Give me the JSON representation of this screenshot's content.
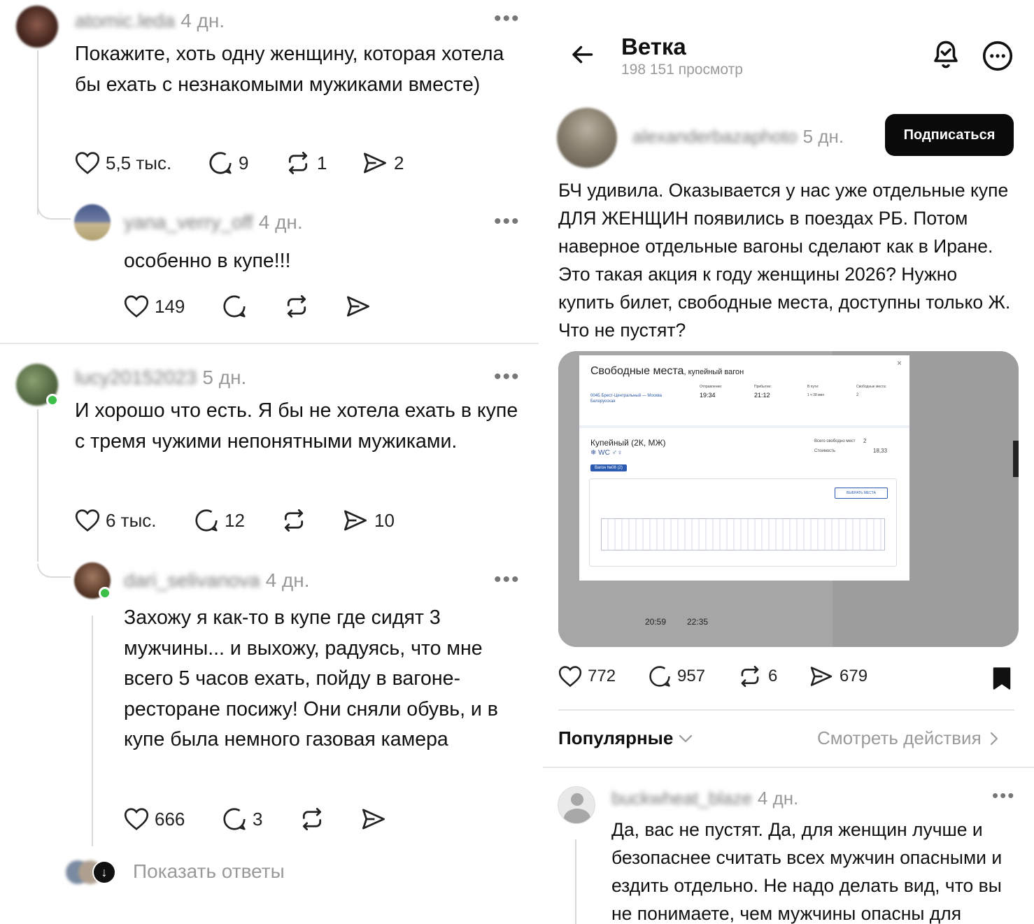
{
  "left": {
    "comments": [
      {
        "username": "atomic.leda",
        "time": "4 дн.",
        "text": "Покажите, хоть одну женщину, которая хотела бы ехать с незнакомыми мужиками вместе)",
        "likes": "5,5 тыс.",
        "replies": "9",
        "reposts": "1",
        "shares": "2"
      },
      {
        "username": "yana_verry_off",
        "time": "4 дн.",
        "text": "особенно в купе!!!",
        "likes": "149",
        "replies": "",
        "reposts": "",
        "shares": ""
      },
      {
        "username": "lucy20152023",
        "time": "5 дн.",
        "text": "И хорошо что есть. Я бы не хотела ехать в купе с тремя чужими непонятными мужиками.",
        "likes": "6 тыс.",
        "replies": "12",
        "reposts": "",
        "shares": "10"
      },
      {
        "username": "dari_selivanova",
        "time": "4 дн.",
        "text": "Захожу я как-то в купе где сидят 3 мужчины... и выхожу, радуясь, что мне всего 5 часов ехать, пойду в вагоне-ресторане посижу! Они сняли обувь, и в купе была немного газовая камера",
        "likes": "666",
        "replies": "3",
        "reposts": "",
        "shares": ""
      }
    ],
    "show_replies": "Показать ответы"
  },
  "right": {
    "header": {
      "title": "Ветка",
      "views": "198 151 просмотр"
    },
    "post": {
      "username": "alexanderbazaphoto",
      "time": "5 дн.",
      "subscribe": "Подписаться",
      "text": "БЧ удивила. Оказывается у нас уже отдельные купе ДЛЯ ЖЕНЩИН появились в поездах РБ. Потом наверное отдельные вагоны сделают как в Иране. Это такая акция к году женщины 2026? Нужно купить билет, свободные места, доступны только Ж. Что не пустят?",
      "likes": "772",
      "replies": "957",
      "reposts": "6",
      "shares": "679"
    },
    "screenshot": {
      "modal_title": "Свободные места",
      "modal_subtitle": ", купейный вагон",
      "train": "004Б Брест-Центральный — Москва Белорусская",
      "departure_label": "Отправление:",
      "departure": "19:34",
      "arrival_label": "Прибытие:",
      "arrival": "21:12",
      "in_transit_label": "В пути:",
      "in_transit": "1 ч 38 мин",
      "free_label": "Свободные места:",
      "free": "2",
      "car_type": "Купейный (2К, МЖ)",
      "total_free_label": "Всего свободно мест",
      "total_free": "2",
      "price_label": "Стоимость",
      "price": "18,33",
      "car_tag": "Вагон №08 (2)",
      "choose_btn": "ВЫБРАТЬ МЕСТА",
      "bottom_dep": "20:59",
      "bottom_arr": "22:35"
    },
    "sort": {
      "label": "Популярные",
      "activity": "Смотреть действия"
    },
    "reply": {
      "username": "buckwheat_blaze",
      "time": "4 дн.",
      "text": "Да, вас не пустят. Да, для женщин лучше и безопаснее считать всех мужчин опасными и ездить отдельно. Не надо делать вид, что вы не понимаете, чем мужчины опасны для"
    }
  },
  "colors": {
    "accent_dark": "#0a0a0a",
    "muted": "#9a9a9a",
    "link_blue": "#2a5aa8"
  }
}
